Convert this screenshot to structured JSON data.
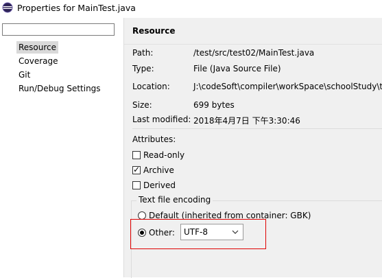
{
  "window": {
    "title": "Properties for MainTest.java",
    "icon": "eclipse-icon"
  },
  "sidebar": {
    "filter_placeholder": "",
    "items": [
      {
        "label": "Resource",
        "selected": true
      },
      {
        "label": "Coverage",
        "selected": false
      },
      {
        "label": "Git",
        "selected": false
      },
      {
        "label": "Run/Debug Settings",
        "selected": false
      }
    ]
  },
  "main": {
    "title": "Resource",
    "properties": [
      {
        "label": "Path:",
        "value": "/test/src/test02/MainTest.java"
      },
      {
        "label": "Type:",
        "value": "File  (Java Source File)"
      },
      {
        "label": "Location:",
        "value": "J:\\codeSoft\\compiler\\workSpace\\schoolStudy\\t"
      },
      {
        "label": "Size:",
        "value": "699  bytes"
      },
      {
        "label": "Last modified:",
        "value": "2018年4月7日 下午3:30:46"
      }
    ],
    "attributes_label": "Attributes:",
    "attributes": [
      {
        "label": "Read-only",
        "checked": false
      },
      {
        "label": "Archive",
        "checked": true
      },
      {
        "label": "Derived",
        "checked": false
      }
    ],
    "encoding": {
      "group_title": "Text file encoding",
      "default_label": "Default (inherited from container: GBK)",
      "default_selected": false,
      "other_label": "Other:",
      "other_selected": true,
      "other_value": "UTF-8"
    }
  },
  "colors": {
    "highlight_border": "#e00000",
    "selected_item_bg": "#d9d9d9",
    "panel_bg": "#f0f0f0"
  }
}
